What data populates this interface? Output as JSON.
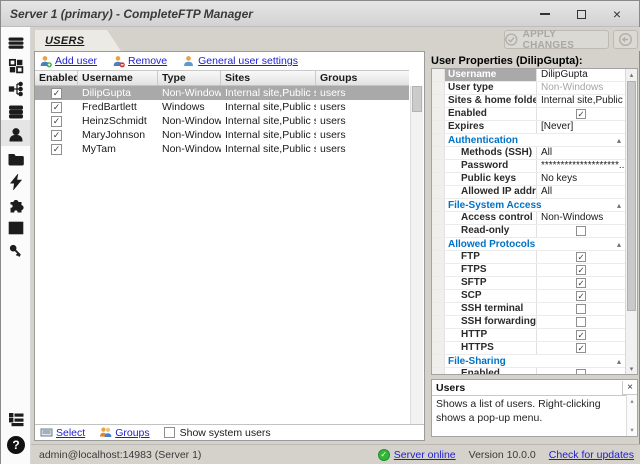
{
  "window": {
    "title": "Server 1 (primary) - CompleteFTP Manager"
  },
  "tab": {
    "label": "USERS"
  },
  "apply": {
    "label": "APPLY CHANGES"
  },
  "toolbar": {
    "add_user": "Add user",
    "remove": "Remove",
    "general_settings": "General user settings"
  },
  "table": {
    "columns": [
      "Enabled",
      "Username",
      "Type",
      "Sites",
      "Groups"
    ],
    "rows": [
      {
        "enabled": true,
        "username": "DilipGupta",
        "type": "Non-Windows",
        "sites": "Internal site,Public site",
        "groups": "users",
        "selected": true
      },
      {
        "enabled": true,
        "username": "FredBartlett",
        "type": "Windows",
        "sites": "Internal site,Public site",
        "groups": "users",
        "selected": false
      },
      {
        "enabled": true,
        "username": "HeinzSchmidt",
        "type": "Non-Windows",
        "sites": "Internal site,Public site",
        "groups": "users",
        "selected": false
      },
      {
        "enabled": true,
        "username": "MaryJohnson",
        "type": "Non-Windows",
        "sites": "Internal site,Public site",
        "groups": "users",
        "selected": false
      },
      {
        "enabled": true,
        "username": "MyTam",
        "type": "Non-Windows",
        "sites": "Internal site,Public site",
        "groups": "users",
        "selected": false
      }
    ]
  },
  "panel_footer": {
    "select": "Select",
    "groups": "Groups",
    "show_system_users": "Show system users",
    "show_system_users_checked": false
  },
  "properties": {
    "title": "User Properties (DilipGupta):",
    "rows": [
      {
        "kind": "prop",
        "label": "Username",
        "value": "DilipGupta",
        "selected": true
      },
      {
        "kind": "prop",
        "label": "User type",
        "value": "Non-Windows",
        "muted": true
      },
      {
        "kind": "prop",
        "label": "Sites & home folders",
        "value": "Internal site,Public site"
      },
      {
        "kind": "prop",
        "label": "Enabled",
        "checkbox": true,
        "checked": true
      },
      {
        "kind": "prop",
        "label": "Expires",
        "value": "[Never]"
      },
      {
        "kind": "cat",
        "label": "Authentication"
      },
      {
        "kind": "prop",
        "label": "Methods (SSH)",
        "value": "All",
        "indent": 2
      },
      {
        "kind": "prop",
        "label": "Password",
        "value": "********************...",
        "indent": 2
      },
      {
        "kind": "prop",
        "label": "Public keys",
        "value": "No keys",
        "indent": 2
      },
      {
        "kind": "prop",
        "label": "Allowed IP addresses",
        "value": "All",
        "indent": 2
      },
      {
        "kind": "cat",
        "label": "File-System Access"
      },
      {
        "kind": "prop",
        "label": "Access control",
        "value": "Non-Windows",
        "indent": 2
      },
      {
        "kind": "prop",
        "label": "Read-only",
        "checkbox": true,
        "checked": false,
        "indent": 2
      },
      {
        "kind": "cat",
        "label": "Allowed Protocols"
      },
      {
        "kind": "prop",
        "label": "FTP",
        "checkbox": true,
        "checked": true,
        "indent": 2
      },
      {
        "kind": "prop",
        "label": "FTPS",
        "checkbox": true,
        "checked": true,
        "indent": 2
      },
      {
        "kind": "prop",
        "label": "SFTP",
        "checkbox": true,
        "checked": true,
        "indent": 2
      },
      {
        "kind": "prop",
        "label": "SCP",
        "checkbox": true,
        "checked": true,
        "indent": 2
      },
      {
        "kind": "prop",
        "label": "SSH terminal",
        "checkbox": true,
        "checked": false,
        "indent": 2
      },
      {
        "kind": "prop",
        "label": "SSH forwarding",
        "checkbox": true,
        "checked": false,
        "indent": 2
      },
      {
        "kind": "prop",
        "label": "HTTP",
        "checkbox": true,
        "checked": true,
        "indent": 2
      },
      {
        "kind": "prop",
        "label": "HTTPS",
        "checkbox": true,
        "checked": true,
        "indent": 2
      },
      {
        "kind": "cat",
        "label": "File-Sharing"
      },
      {
        "kind": "prop",
        "label": "Enabled",
        "checkbox": true,
        "checked": false,
        "indent": 2
      }
    ]
  },
  "help": {
    "title": "Users",
    "text": "Shows a list of users.  Right-clicking shows a pop-up menu."
  },
  "statusbar": {
    "connection": "admin@localhost:14983 (Server 1)",
    "server_online": "Server online",
    "version": "Version 10.0.0",
    "check_updates": "Check for updates"
  },
  "sidebar": {
    "icons": [
      "menu",
      "dashboard",
      "sites",
      "servers",
      "users",
      "folders",
      "events",
      "extensions",
      "monitoring",
      "licensing",
      "log",
      "help"
    ],
    "active": "users"
  },
  "colors": {
    "category_blue": "#0072c6",
    "link_blue": "#1d1dcf",
    "selection_gray": "#a9a9a9",
    "online_green": "#33b53a"
  }
}
